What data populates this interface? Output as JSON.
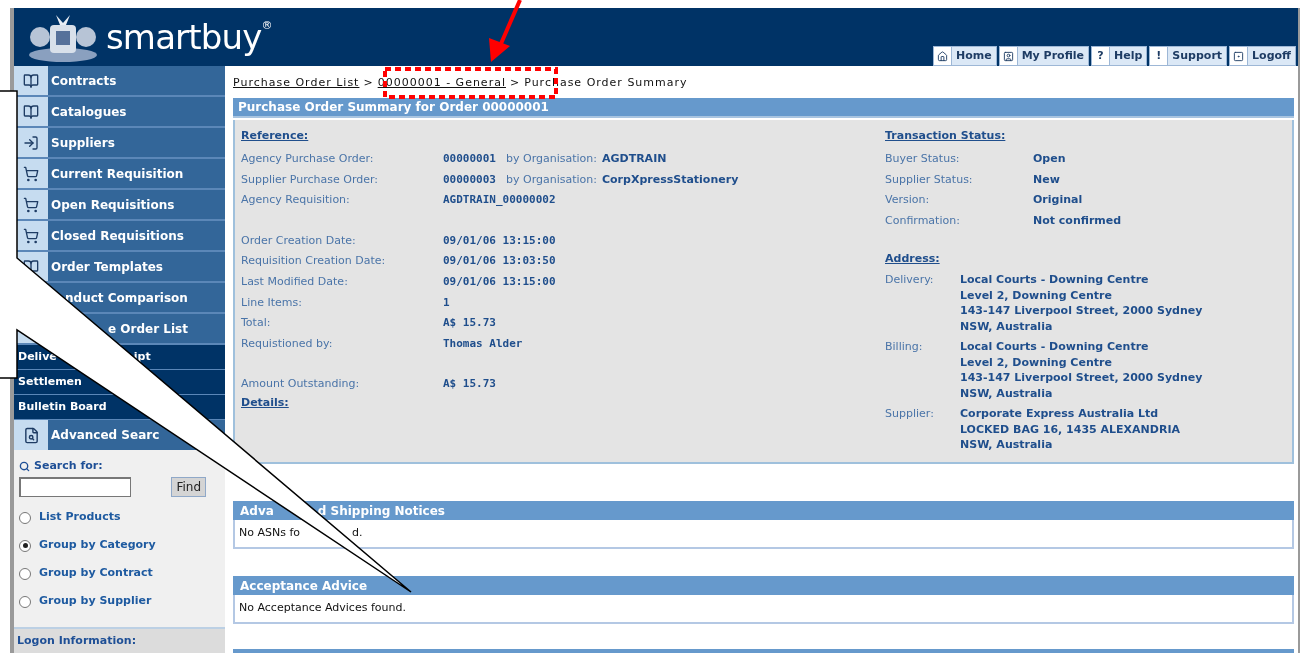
{
  "header": {
    "logo": "smartbuy",
    "logo_mark": "®",
    "nav": [
      {
        "label": "Home",
        "kind": "home"
      },
      {
        "label": "My Profile",
        "kind": "profile"
      },
      {
        "label": "Help",
        "kind": "glyph",
        "glyph": "?"
      },
      {
        "label": "Support",
        "kind": "glyph",
        "glyph": "!"
      },
      {
        "label": "Logoff",
        "kind": "logoff"
      }
    ]
  },
  "sidebar": {
    "menu": [
      {
        "label": "Contracts"
      },
      {
        "label": "Catalogues"
      },
      {
        "label": "Suppliers"
      },
      {
        "label": "Current Requisition"
      },
      {
        "label": "Open Requisitions"
      },
      {
        "label": "Closed Requisitions"
      },
      {
        "label": "Order Templates"
      },
      {
        "label": "nduct Comparison"
      },
      {
        "label": "e Order List"
      }
    ],
    "plain": [
      {
        "parts": [
          "Delive",
          "ipt"
        ]
      },
      {
        "parts": [
          "Settlemen"
        ]
      },
      {
        "parts": [
          "Bulletin Board"
        ]
      }
    ],
    "search": {
      "title": "Advanced Searc",
      "search_label": "Search for:",
      "find": "Find",
      "options": [
        {
          "label": "List Products",
          "selected": false
        },
        {
          "label": "Group by Category",
          "selected": true
        },
        {
          "label": "Group by Contract",
          "selected": false
        },
        {
          "label": "Group by Supplier",
          "selected": false
        }
      ]
    },
    "logon": "Logon Information:"
  },
  "breadcrumb": [
    {
      "label": "Purchase Order List",
      "kind": "link"
    },
    {
      "label": ">",
      "kind": "separator"
    },
    {
      "label": "00000001 - General",
      "kind": "link"
    },
    {
      "label": ">",
      "kind": "separator"
    },
    {
      "label": "Purchase Order Summary",
      "kind": "current"
    }
  ],
  "summary": {
    "title": "Purchase Order Summary for Order 00000001",
    "reference": {
      "heading": "Reference:",
      "groups": [
        [
          {
            "label": "Agency Purchase Order:",
            "value": "00000001",
            "org_label": "by Organisation:",
            "org_value": "AGDTRAIN"
          },
          {
            "label": "Supplier Purchase Order:",
            "value": "00000003",
            "org_label": "by Organisation:",
            "org_value": "CorpXpressStationery"
          },
          {
            "label": "Agency Requisition:",
            "value": "AGDTRAIN_00000002"
          }
        ],
        [
          {
            "label": "Order Creation Date:",
            "value": "09/01/06 13:15:00"
          },
          {
            "label": "Requisition Creation Date:",
            "value": "09/01/06 13:03:50"
          },
          {
            "label": "Last Modified Date:",
            "value": "09/01/06 13:15:00"
          },
          {
            "label": "Line Items:",
            "value": "1"
          },
          {
            "label": "Total:",
            "value": "A$ 15.73"
          },
          {
            "label": "Requistioned by:",
            "value": "Thomas Alder"
          }
        ],
        [
          {
            "label": "Amount Outstanding:",
            "value": "A$ 15.73"
          }
        ]
      ],
      "details": "Details:"
    },
    "status": {
      "heading": "Transaction Status:",
      "rows": [
        {
          "label": "Buyer Status:",
          "value": "Open"
        },
        {
          "label": "Supplier Status:",
          "value": "New"
        },
        {
          "label": "Version:",
          "value": "Original"
        },
        {
          "label": "Confirmation:",
          "value": "Not confirmed"
        }
      ]
    },
    "address": {
      "heading": "Address:",
      "rows": [
        {
          "label": "Delivery:",
          "lines": [
            "Local Courts - Downing Centre",
            "Level 2, Downing Centre",
            "143-147 Liverpool Street, 2000 Sydney",
            "NSW, Australia"
          ]
        },
        {
          "label": "Billing:",
          "lines": [
            "Local Courts - Downing Centre",
            "Level 2, Downing Centre",
            "143-147 Liverpool Street, 2000 Sydney",
            "NSW, Australia"
          ]
        },
        {
          "label": "Supplier:",
          "lines": [
            "Corporate Express Australia Ltd",
            "LOCKED BAG 16, 1435 ALEXANDRIA",
            "NSW, Australia"
          ]
        }
      ]
    }
  },
  "sections": [
    {
      "title_parts": [
        "Adva",
        "d Shipping Notices"
      ],
      "message_parts": [
        "No ASNs fo",
        "d."
      ]
    },
    {
      "title_parts": [
        "Acceptance Advice"
      ],
      "message_parts": [
        "No Acceptance Advices found."
      ]
    }
  ]
}
